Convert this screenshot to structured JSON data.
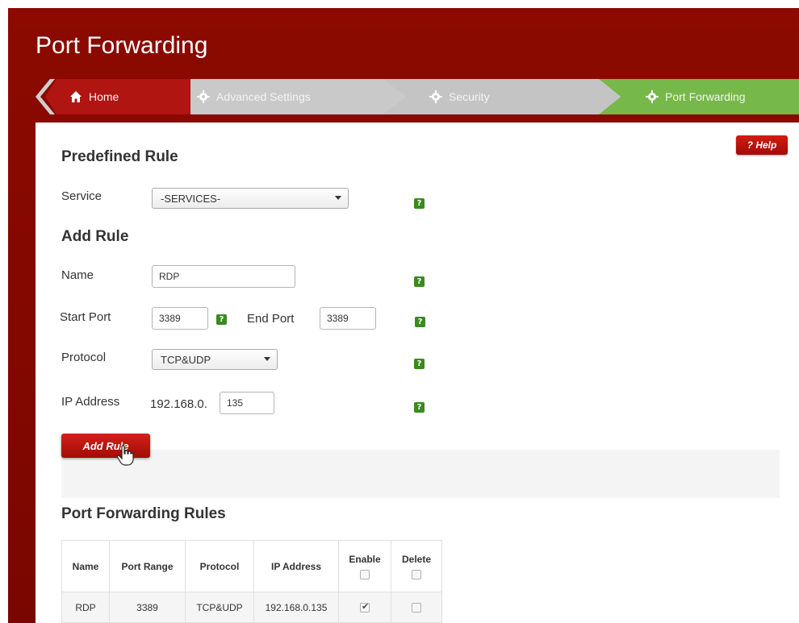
{
  "page": {
    "title": "Port Forwarding"
  },
  "breadcrumb": {
    "home": "Home",
    "advanced": "Advanced Settings",
    "security": "Security",
    "port_forwarding": "Port Forwarding"
  },
  "help_label": "? Help",
  "predefined": {
    "heading": "Predefined Rule",
    "service_label": "Service",
    "service_value": "-SERVICES-"
  },
  "add_rule": {
    "heading": "Add Rule",
    "name_label": "Name",
    "name_value": "RDP",
    "start_port_label": "Start Port",
    "start_port_value": "3389",
    "end_port_label": "End Port",
    "end_port_value": "3389",
    "protocol_label": "Protocol",
    "protocol_value": "TCP&UDP",
    "ip_label": "IP Address",
    "ip_prefix": "192.168.0.",
    "ip_last_octet": "135",
    "button_label": "Add Rule"
  },
  "rules": {
    "heading": "Port Forwarding Rules",
    "columns": [
      "Name",
      "Port Range",
      "Protocol",
      "IP Address",
      "Enable",
      "Delete"
    ],
    "rows": [
      {
        "name": "RDP",
        "port_range": "3389",
        "protocol": "TCP&UDP",
        "ip": "192.168.0.135",
        "enabled": true,
        "delete": false
      }
    ]
  },
  "colors": {
    "brand_red": "#8c0a00",
    "active_crumb": "#76b84a",
    "help_green": "#3a8a1e"
  },
  "icons": {
    "home": "home-icon",
    "gear": "gear-icon",
    "help": "help-icon",
    "cursor": "hand-cursor-icon"
  }
}
